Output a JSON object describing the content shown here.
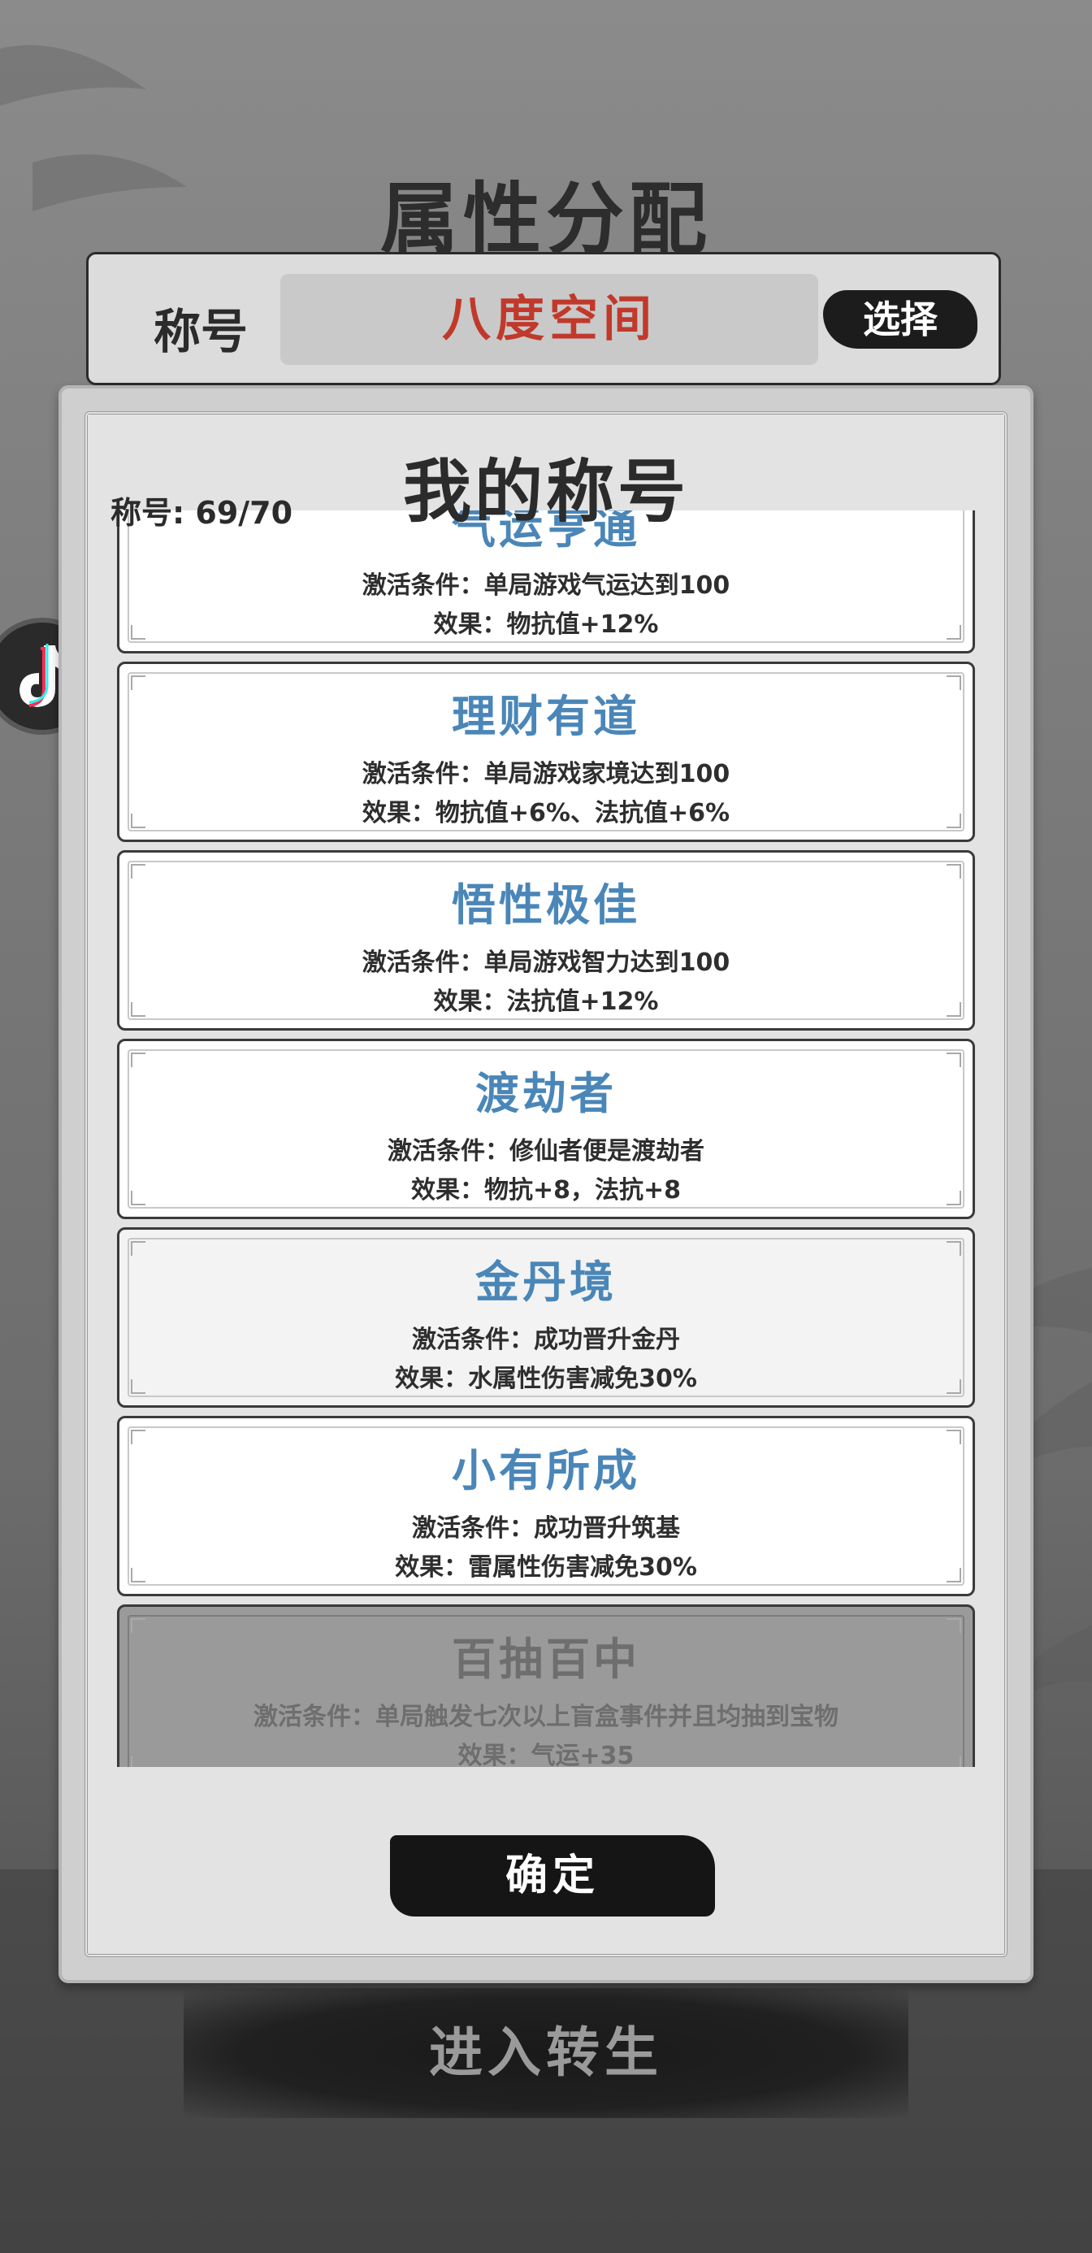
{
  "screen_title": "属性分配",
  "title_bar": {
    "label": "称号",
    "current_title": "八度空间",
    "choose_label": "选择"
  },
  "modal": {
    "title": "我的称号",
    "count": "称号: 69/70",
    "titles": [
      {
        "name": "气运亨通",
        "condition": "激活条件：单局游戏气运达到100",
        "effect": "效果：物抗值+12%",
        "state": "active"
      },
      {
        "name": "理财有道",
        "condition": "激活条件：单局游戏家境达到100",
        "effect": "效果：物抗值+6%、法抗值+6%",
        "state": "active"
      },
      {
        "name": "悟性极佳",
        "condition": "激活条件：单局游戏智力达到100",
        "effect": "效果：法抗值+12%",
        "state": "active"
      },
      {
        "name": "渡劫者",
        "condition": "激活条件：修仙者便是渡劫者",
        "effect": "效果：物抗+8，法抗+8",
        "state": "active"
      },
      {
        "name": "金丹境",
        "condition": "激活条件：成功晋升金丹",
        "effect": "效果：水属性伤害减免30%",
        "state": "highlight"
      },
      {
        "name": "小有所成",
        "condition": "激活条件：成功晋升筑基",
        "effect": "效果：雷属性伤害减免30%",
        "state": "active"
      },
      {
        "name": "百抽百中",
        "condition": "激活条件：单局触发七次以上盲盒事件并且均抽到宝物",
        "effect": "效果：气运+35",
        "state": "locked"
      }
    ],
    "confirm_label": "确定"
  },
  "reincarnate_label": "进入转生",
  "colors": {
    "title_name": "#4a86b8",
    "current_title": "#c0392b",
    "locked_card": "#9a9a9a"
  }
}
